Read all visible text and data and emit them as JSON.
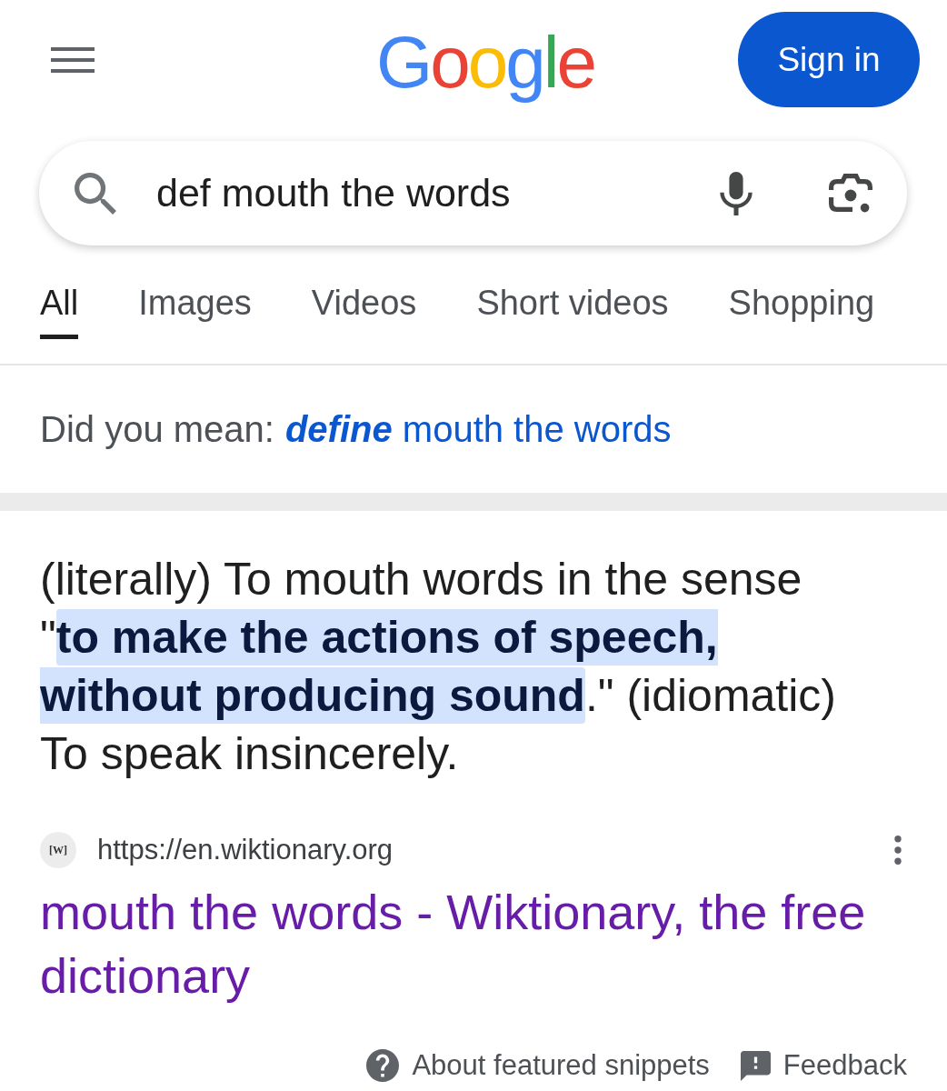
{
  "header": {
    "logo": "Google",
    "sign_in": "Sign in"
  },
  "search": {
    "value": "def mouth the words"
  },
  "tabs": [
    {
      "label": "All",
      "selected": true
    },
    {
      "label": "Images",
      "selected": false
    },
    {
      "label": "Videos",
      "selected": false
    },
    {
      "label": "Short videos",
      "selected": false
    },
    {
      "label": "Shopping",
      "selected": false
    }
  ],
  "did_you_mean": {
    "label": "Did you mean:",
    "suggestion": "**define** mouth the words"
  },
  "snippet": {
    "text": "(literally) To mouth words in the sense \"**to make the actions of speech, without producing sound**.\" (idiomatic) To speak insincerely."
  },
  "source": {
    "favicon": "[W]",
    "url": "https://en.wiktionary.org",
    "title": "mouth the words - Wiktionary, the free dictionary"
  },
  "footer": [
    {
      "kind": "help",
      "label": "About featured snippets"
    },
    {
      "kind": "feedback",
      "label": "Feedback"
    }
  ]
}
